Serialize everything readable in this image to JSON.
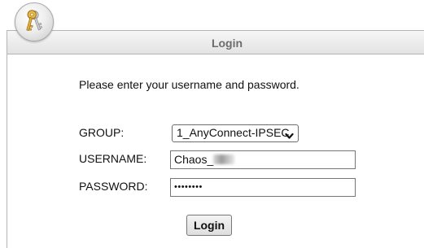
{
  "header": {
    "title": "Login",
    "icon": "keys-icon"
  },
  "form": {
    "instructions": "Please enter your username and password.",
    "group_label": "GROUP:",
    "group_value": "1_AnyConnect-IPSEC",
    "username_label": "USERNAME:",
    "username_value": "Chaos_",
    "password_label": "PASSWORD:",
    "password_value": "••••••••",
    "login_button": "Login"
  }
}
